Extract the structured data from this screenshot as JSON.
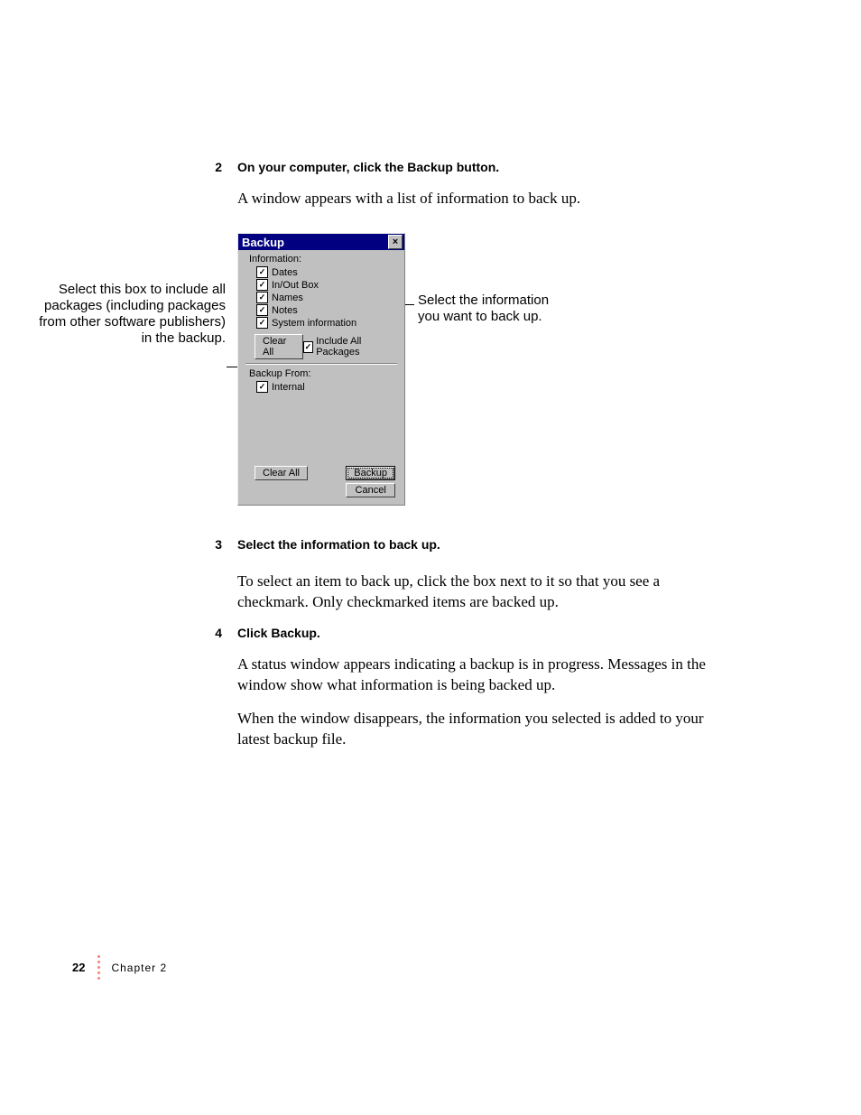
{
  "steps": {
    "s2": {
      "num": "2",
      "title": "On your computer, click the Backup button.",
      "body": "A window appears with a list of information to back up."
    },
    "s3": {
      "num": "3",
      "title": "Select the information to back up.",
      "body": "To select an item to back up, click the box next to it so that you see a checkmark. Only checkmarked items are backed up."
    },
    "s4": {
      "num": "4",
      "title": "Click Backup.",
      "body1": "A status window appears indicating a backup is in progress. Messages in the window show what information is being backed up.",
      "body2": "When the window disappears, the information you selected is added to your latest backup file."
    }
  },
  "dialog": {
    "title": "Backup",
    "info_label": "Information:",
    "items": {
      "dates": "Dates",
      "inout": "In/Out Box",
      "names": "Names",
      "notes": "Notes",
      "sysinfo": "System information"
    },
    "clear_all": "Clear All",
    "include_pkg": "Include All Packages",
    "from_label": "Backup From:",
    "internal": "Internal",
    "backup": "Backup",
    "cancel": "Cancel"
  },
  "callouts": {
    "left": "Select this box to include all packages (including packages from other software publishers) in the backup.",
    "right": "Select the information you want to back up."
  },
  "footer": {
    "page": "22",
    "chapter": "Chapter 2"
  }
}
